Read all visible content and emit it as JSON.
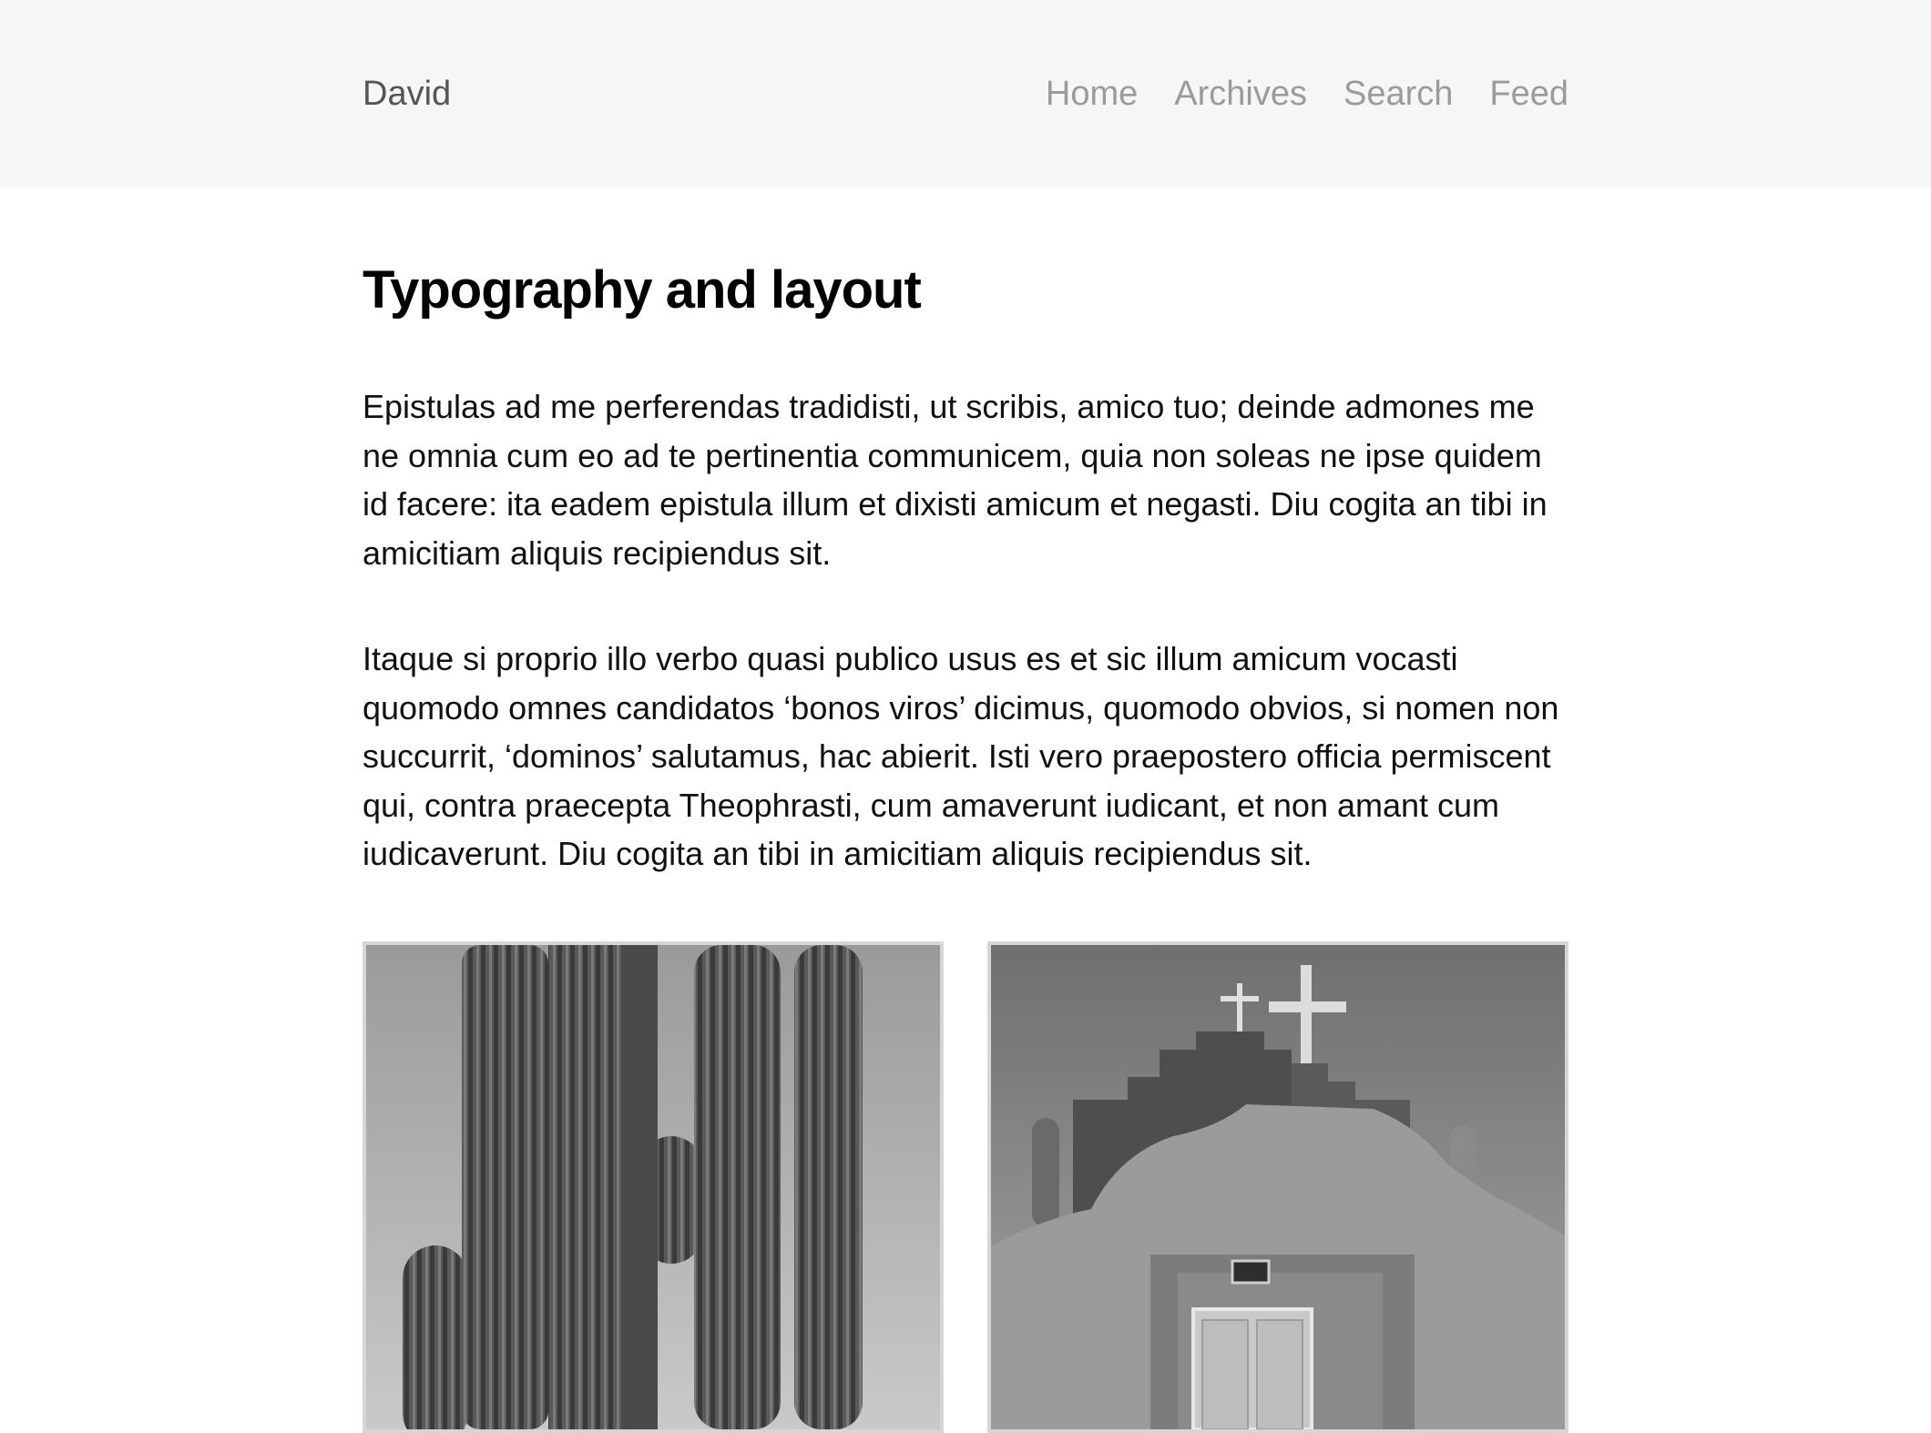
{
  "header": {
    "site_title": "David",
    "nav": [
      "Home",
      "Archives",
      "Search",
      "Feed"
    ]
  },
  "post": {
    "title": "Typography and layout",
    "paragraphs": [
      "Epistulas ad me perferendas tradidisti, ut scribis, amico tuo; deinde admones me ne omnia cum eo ad te pertinentia communicem, quia non soleas ne ipse quidem id facere: ita eadem epistula illum et dixisti amicum et negasti. Diu cogita an tibi in amicitiam aliquis recipiendus sit.",
      "Itaque si proprio illo verbo quasi publico usus es et sic illum amicum vocasti quomodo omnes candidatos ‘bonos viros’ dicimus, quomodo obvios, si nomen non succurrit, ‘dominos’ salutamus, hac abierit. Isti vero praepostero officia permiscent qui, contra praecepta Theophrasti, cum amaverunt iudicant, et non amant cum iudicaverunt. Diu cogita an tibi in amicitiam aliquis recipiendus sit."
    ]
  },
  "gallery": {
    "images": [
      {
        "subject": "saguaro-cactus-photo"
      },
      {
        "subject": "adobe-church-photo"
      }
    ]
  }
}
